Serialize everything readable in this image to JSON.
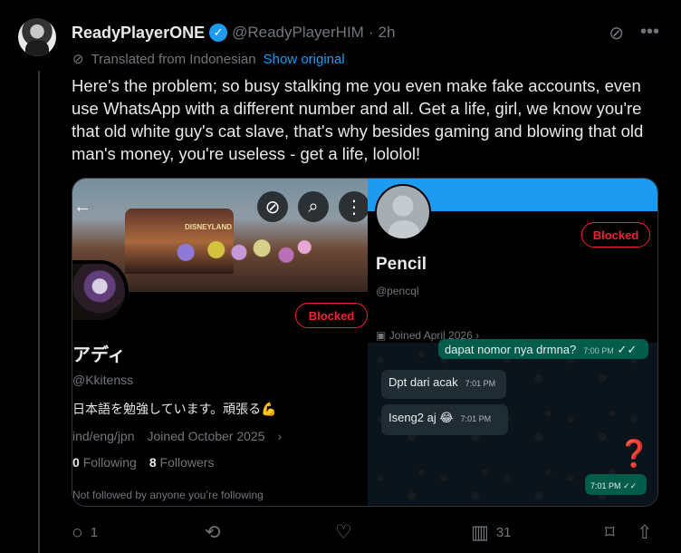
{
  "tweet": {
    "display_name": "ReadyPlayerONE",
    "verified_icon": "verified-badge-icon",
    "handle": "@ReadyPlayerHIM",
    "separator": "·",
    "time": "2h",
    "translated_label": "Translated from Indonesian",
    "show_original": "Show original",
    "text": "Here's the problem; so busy stalking me you even make fake accounts, even use WhatsApp with a different number and all. Get a life, girl, we know you're that old white guy's cat slave, that's why besides gaming and blowing that old man's money, you're useless - get a life, lololol!"
  },
  "top_actions": {
    "mute_icon": "mute-icon",
    "more_icon": "more-icon"
  },
  "left_screenshot": {
    "back_icon": "back-arrow-icon",
    "mute_icon": "mute-icon",
    "search_icon": "search-icon",
    "more_icon": "more-vertical-icon",
    "banner_sign": "DISNEYLAND",
    "blocked_label": "Blocked",
    "name": "アディ",
    "handle": "@Kkitenss",
    "bio": "日本語を勉強しています。頑張る💪",
    "location": "ind/eng/jpn",
    "joined": "Joined October 2025",
    "following_count": "0",
    "following_label": "Following",
    "followers_count": "8",
    "followers_label": "Followers",
    "not_followed": "Not followed by anyone you’re following"
  },
  "right_screenshot": {
    "blocked_label": "Blocked",
    "name": "Pencil",
    "handle": "@pencql",
    "joined": "Joined April 2026",
    "chat": {
      "message_1": "dapat nomor nya drmna?",
      "message_1_time": "7:00 PM",
      "message_2": "Dpt dari acak",
      "message_2_time": "7:01 PM",
      "message_3": "Iseng2 aj 😂",
      "message_3_time": "7:01 PM",
      "question_mark": "❓",
      "message_4_time": "7:01 PM"
    }
  },
  "actions": {
    "reply_count": "1",
    "repost_count": "",
    "like_count": "",
    "views_count": "31"
  },
  "colors": {
    "accent": "#1d9bf0",
    "blocked": "#f4212e",
    "muted_text": "#71767b",
    "whatsapp_out": "#005c4b",
    "whatsapp_in": "#202c33"
  }
}
